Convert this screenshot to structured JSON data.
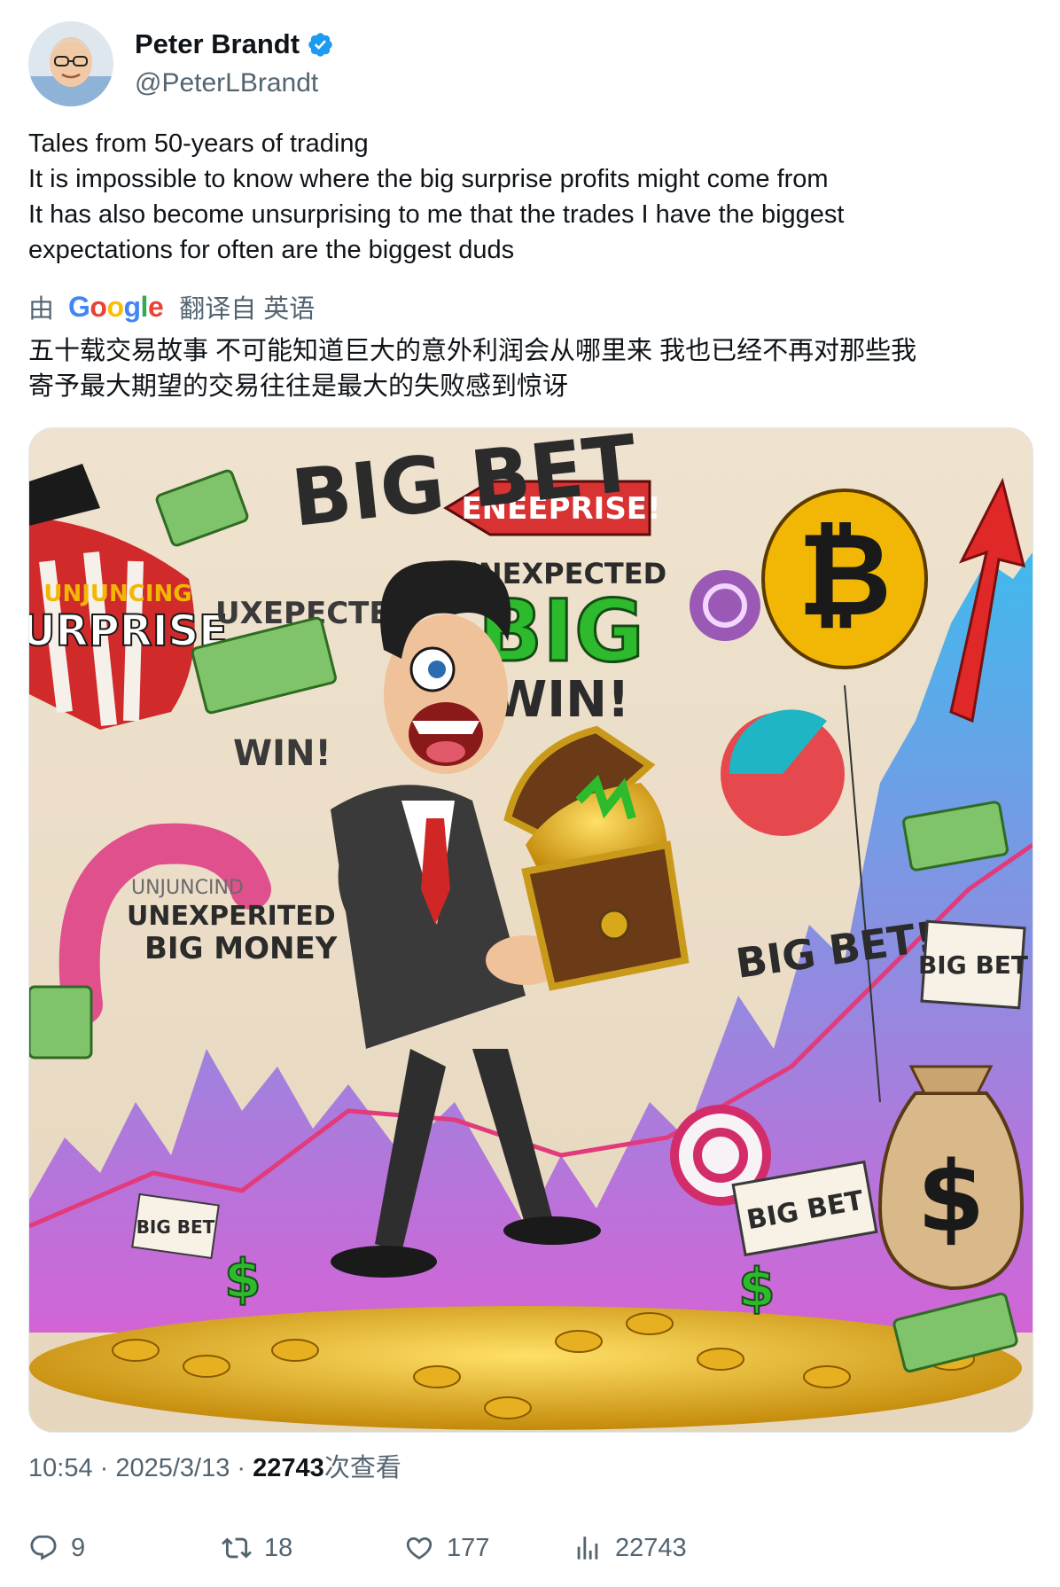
{
  "author": {
    "display_name": "Peter Brandt",
    "handle": "@PeterLBrandt",
    "verified_icon": "verified-badge-icon",
    "avatar_icon": "avatar"
  },
  "tweet": {
    "lines": [
      "Tales from 50-years of trading",
      "It is impossible to know where the big surprise profits might come from",
      "It has also become unsurprising to me that the trades I have the biggest",
      "expectations for often are the biggest duds"
    ]
  },
  "translation": {
    "by_label": "由",
    "google_label": "Google",
    "from_label": "翻译自 英语",
    "lines": [
      "五十载交易故事 不可能知道巨大的意外利润会从哪里来 我也已经不再对那些我",
      "寄予最大期望的交易往往是最大的失败感到惊讶"
    ]
  },
  "media": {
    "texts": {
      "big_bet": "BIG BET",
      "enterprise_sign": "ENEEPRISE!",
      "unexpected": "UNEXPECTED",
      "big": "BIG",
      "win": "WIN!",
      "uxepected": "UXEPECTEN",
      "surprise": "SURPRISE",
      "unjuncing": "UNJUNCING",
      "win_small": "WIN!",
      "unjuncind": "UNJUNCIND",
      "unexperited": "UNEXPERITED",
      "big_money": "BIG MONEY",
      "big_bet_right": "BIG BET!",
      "big_bet_sign": "BIG BET",
      "big_bet_bottom": "BIG BET",
      "big_bet_left": "BIG BET",
      "bitcoin_symbol": "₿",
      "dollar_symbol": "$"
    }
  },
  "meta": {
    "time": "10:54",
    "sep1": " · ",
    "date": "2025/3/13",
    "sep2": " · ",
    "views": "22743",
    "views_label": "次查看"
  },
  "actions": {
    "replies": "9",
    "reposts": "18",
    "likes": "177",
    "views": "22743"
  },
  "colors": {
    "verified": "#1d9bf0",
    "secondary_text": "#536471",
    "primary_text": "#0f1419"
  }
}
